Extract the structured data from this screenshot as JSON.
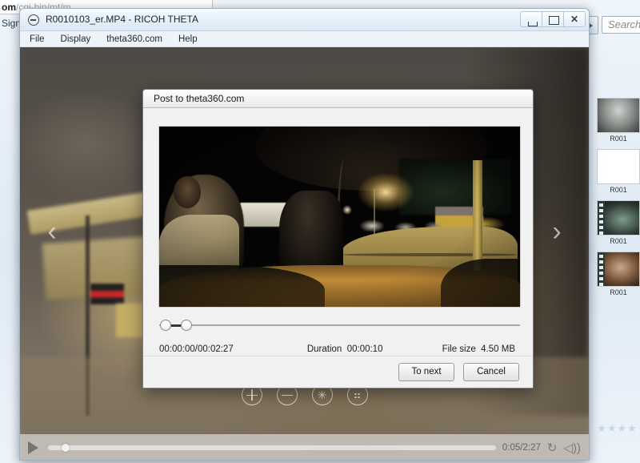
{
  "browser": {
    "url_bold": "om",
    "url_rest": "/cgi-bin/mt/m",
    "sign_in": "Sign i",
    "search_placeholder": "Search C",
    "go_icon": "go-arrow-icon",
    "thumbnails": [
      {
        "caption": "R001",
        "kind": "photo"
      },
      {
        "caption": "R001",
        "kind": "blank"
      },
      {
        "caption": "R001",
        "kind": "video"
      },
      {
        "caption": "R001",
        "kind": "video"
      }
    ],
    "stars": [
      "★",
      "★",
      "★",
      "★"
    ]
  },
  "app": {
    "title": "R0010103_er.MP4 - RICOH THETA",
    "app_icon": "theta-minus-circle-icon",
    "window_buttons": [
      {
        "name": "minimize",
        "glyph": ""
      },
      {
        "name": "maximize",
        "glyph": ""
      },
      {
        "name": "close",
        "glyph": "✕"
      }
    ],
    "menu": [
      "File",
      "Display",
      "theta360.com",
      "Help"
    ],
    "viewer": {
      "prev_arrow": "‹",
      "next_arrow": "›",
      "tools": [
        {
          "name": "zoom-in-button",
          "icon": "plus-circle-icon",
          "glyph": ""
        },
        {
          "name": "zoom-out-button",
          "icon": "minus-circle-icon",
          "glyph": ""
        },
        {
          "name": "reset-view-button",
          "icon": "sparkle-circle-icon",
          "glyph": "✳"
        },
        {
          "name": "fullscreen-button",
          "icon": "expand-circle-icon",
          "glyph": "⠶"
        }
      ]
    },
    "player": {
      "play_icon": "play-icon",
      "time": "0:05/2:27",
      "loop_icon": "↻",
      "volume_icon": "◁))",
      "progress_percent": 3
    }
  },
  "dialog": {
    "title": "Post to theta360.com",
    "preview_alt": "360 equirectangular night street video frame",
    "trim": {
      "start_handle": "trim-start-handle",
      "end_handle": "trim-end-handle"
    },
    "position_time": "00:00:00/00:02:27",
    "duration_label": "Duration",
    "duration_value": "00:00:10",
    "filesize_label": "File size",
    "filesize_value": "4.50  MB",
    "buttons": {
      "primary": "To next",
      "secondary": "Cancel"
    }
  }
}
